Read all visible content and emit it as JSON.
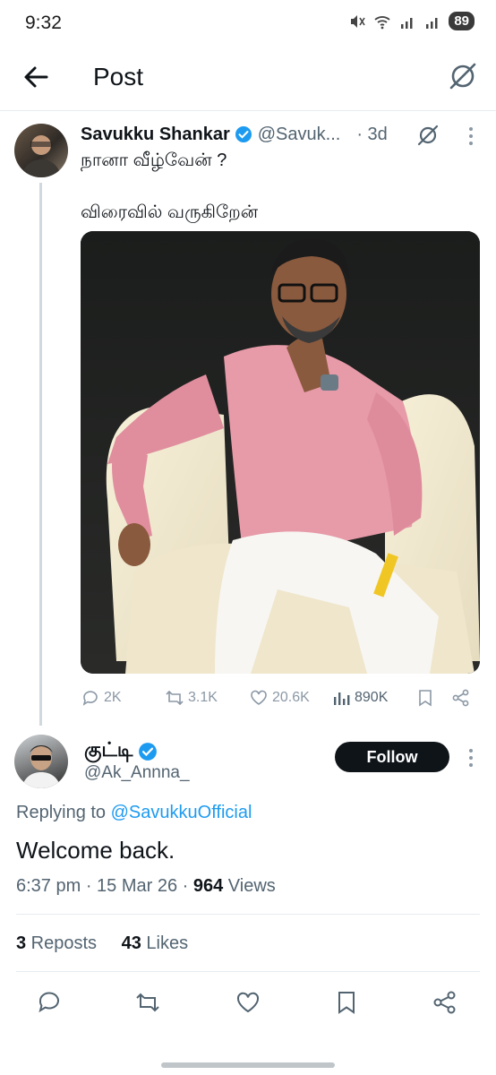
{
  "status_bar": {
    "time": "9:32",
    "battery": "89"
  },
  "header": {
    "title": "Post"
  },
  "parent_post": {
    "display_name": "Savukku Shankar",
    "handle": "@Savuk...",
    "time": "· 3d",
    "line1": "நானா வீழ்வேன் ?",
    "line2": "விரைவில் வருகிறேன்",
    "replies": "2K",
    "reposts": "3.1K",
    "likes": "20.6K",
    "views": "890K"
  },
  "reply_post": {
    "display_name": "குட்டி",
    "handle": "@Ak_Annna_",
    "follow_label": "Follow",
    "replying_prefix": "Replying to ",
    "replying_mention": "@SavukkuOfficial",
    "text": "Welcome back.",
    "timestamp": "6:37 pm · 15 Mar 26 · ",
    "views_count": "964",
    "views_label": " Views",
    "reposts_count": "3",
    "reposts_label": " Reposts",
    "likes_count": "43",
    "likes_label": " Likes"
  },
  "colors": {
    "accent": "#1d9bf0",
    "text": "#0f1419",
    "secondary": "#536471",
    "shirt": "#e79aa8"
  },
  "icons": [
    "back-arrow-icon",
    "grok-icon",
    "verified-badge-icon",
    "more-icon",
    "reply-icon",
    "repost-icon",
    "like-icon",
    "views-icon",
    "bookmark-icon",
    "share-icon"
  ]
}
